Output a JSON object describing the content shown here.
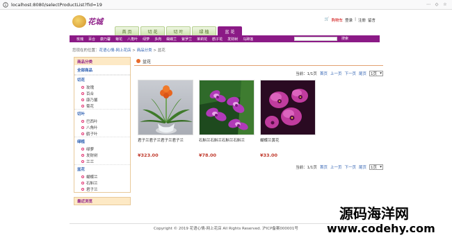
{
  "browser": {
    "url": "localhost:8080/selectProductList?fid=19"
  },
  "logo": {
    "text": "花城"
  },
  "toplinks": {
    "cart": "购物车",
    "login": "登录",
    "sep": "|",
    "register": "注册",
    "message": "留言"
  },
  "navtabs": [
    {
      "label": "首 页",
      "active": false
    },
    {
      "label": "切 花",
      "active": false
    },
    {
      "label": "切 叶",
      "active": false
    },
    {
      "label": "绿 植",
      "active": false
    },
    {
      "label": "盆 花",
      "active": true
    }
  ],
  "catbar": {
    "items": [
      "玫瑰",
      "百合",
      "康乃馨",
      "菊花",
      "八角叶",
      "绿萝",
      "多肉",
      "蝴蝶兰",
      "紫罗兰",
      "茉莉花",
      "鹤子花",
      "发财树",
      "马蹄莲"
    ],
    "search_button": "搜索"
  },
  "breadcrumb": {
    "prefix": "您现在的位置：",
    "home": "花语心情-网上花店",
    "sep1": " > ",
    "category": "商品分类",
    "sep2": " > ",
    "current": "盆花"
  },
  "sidebar": {
    "title": "商品分类",
    "all": "全部商品",
    "groups": [
      {
        "name": "切花",
        "items": [
          "玫瑰",
          "百合",
          "康乃馨",
          "菊花"
        ]
      },
      {
        "name": "切叶",
        "items": [
          "巴西叶",
          "八角叶",
          "鹤子叶"
        ]
      },
      {
        "name": "绿植",
        "items": [
          "绿萝",
          "发财树",
          "兰兰"
        ]
      },
      {
        "name": "盆花",
        "items": [
          "蝴蝶兰",
          "石斛兰",
          "君子兰"
        ]
      }
    ],
    "recent": "最近浏览"
  },
  "main": {
    "title": "盆花",
    "pager": {
      "current": "当前：1/1页",
      "first": "首页",
      "prev": "上一页",
      "next": "下一页",
      "last": "尾页",
      "select": "1页"
    },
    "products": [
      {
        "name": "君子兰君子兰君子兰君子兰",
        "price": "¥323.00",
        "image": "clivia-plant"
      },
      {
        "name": "石斛兰石斛兰石斛兰石斛兰",
        "price": "¥78.00",
        "image": "dendrobium-orchid"
      },
      {
        "name": "蝴蝶兰黄花",
        "price": "¥33.00",
        "image": "phalaenopsis-orchid"
      }
    ]
  },
  "footer": {
    "text": "Copyright © 2019 花语心情-网上花店 All Rights Reserved. 沪ICP备案000001号"
  },
  "watermark": {
    "line1": "源码海洋网",
    "line2": "www.codehy.com"
  }
}
